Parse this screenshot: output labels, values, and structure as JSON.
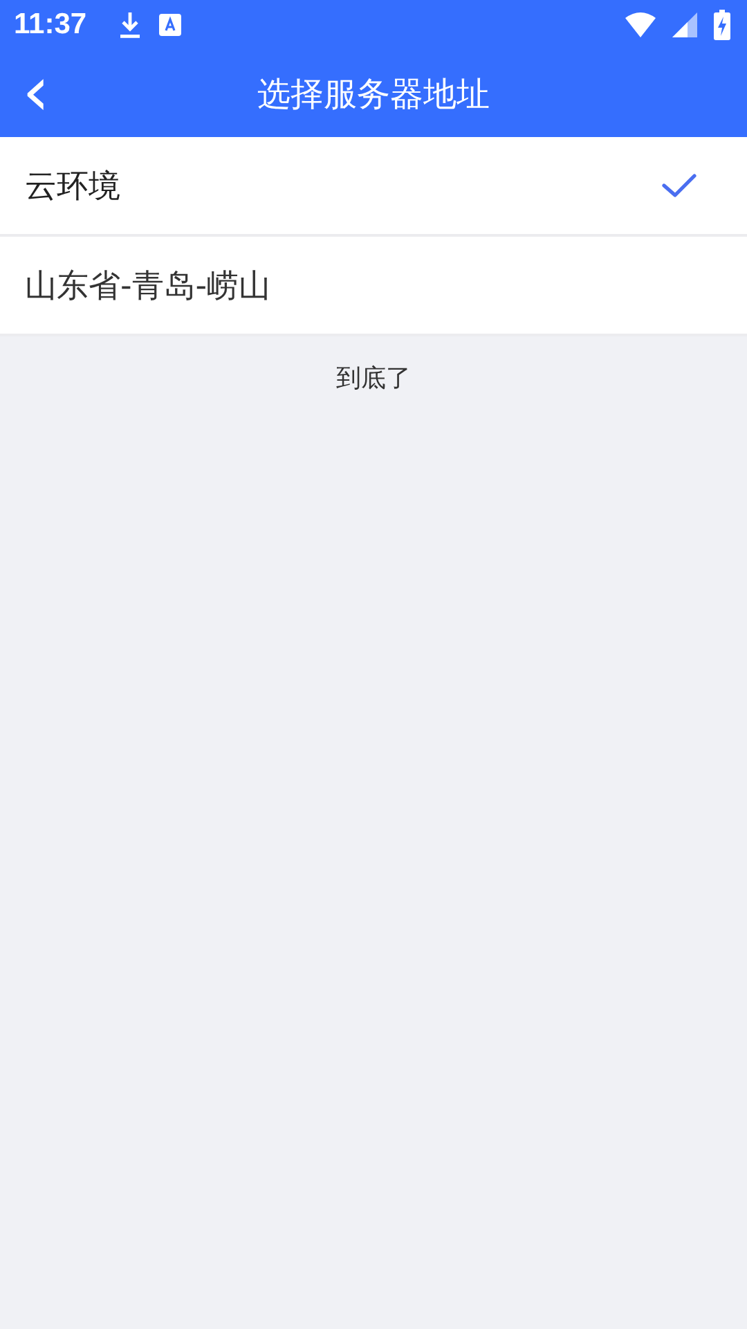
{
  "status_bar": {
    "time": "11:37"
  },
  "header": {
    "back": "‹",
    "title": "选择服务器地址"
  },
  "servers": [
    {
      "name": "云环境",
      "selected": true
    },
    {
      "name": "山东省-青岛-崂山",
      "selected": false
    }
  ],
  "footer": "到底了"
}
